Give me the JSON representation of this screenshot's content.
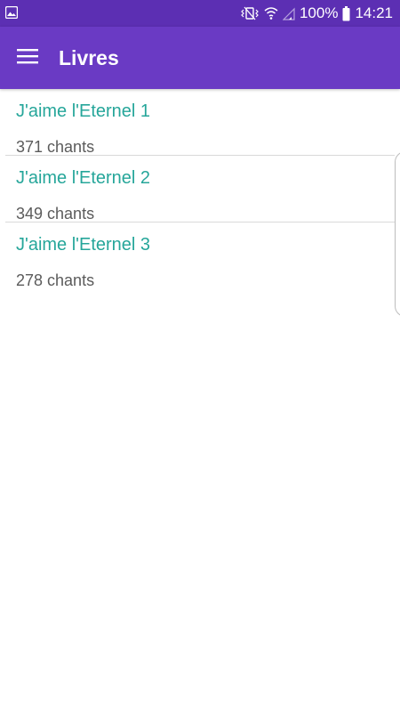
{
  "status_bar": {
    "battery": "100%",
    "time": "14:21"
  },
  "app_bar": {
    "title": "Livres",
    "menu_icon": "hamburger-menu-icon"
  },
  "books": [
    {
      "title": "J'aime l'Eternel 1",
      "count": "371 chants"
    },
    {
      "title": "J'aime l'Eternel 2",
      "count": "349 chants"
    },
    {
      "title": "J'aime l'Eternel 3",
      "count": "278 chants"
    }
  ],
  "colors": {
    "status_bar": "#5c2fb3",
    "app_bar": "#6a3ac4",
    "title_accent": "#26a69a",
    "secondary_text": "#5b5b5b"
  }
}
